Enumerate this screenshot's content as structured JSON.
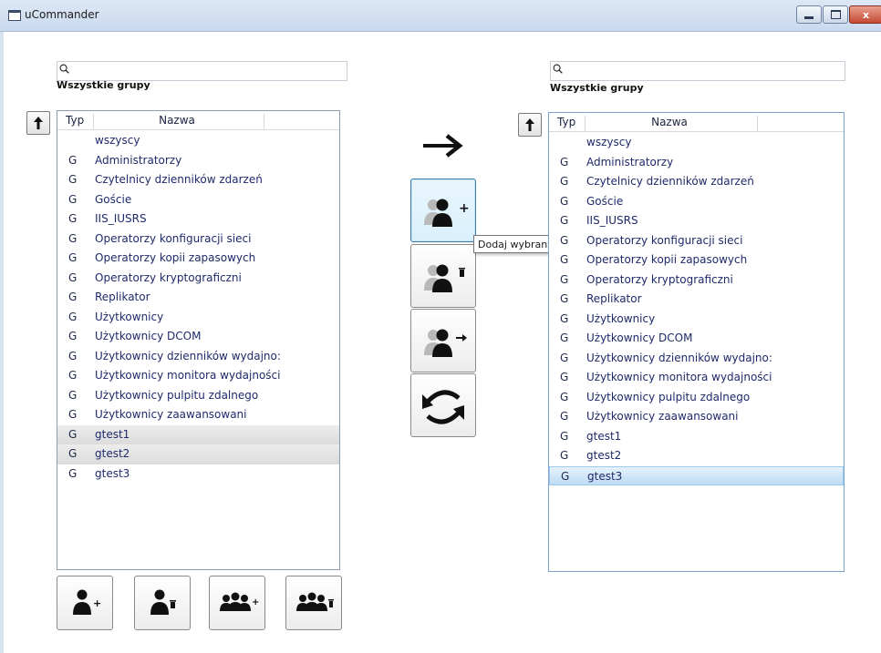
{
  "window": {
    "title": "uCommander",
    "min_glyph": "",
    "max_glyph": "",
    "close_glyph": "x"
  },
  "left_panel": {
    "search": {
      "value": "",
      "placeholder": ""
    },
    "group_label": "Wszystkie grupy",
    "up_button": "🡑",
    "headers": {
      "typ": "Typ",
      "nazwa": "Nazwa"
    },
    "rows": [
      {
        "typ": "",
        "nazwa": "wszyscy",
        "state": "normal"
      },
      {
        "typ": "G",
        "nazwa": "Administratorzy",
        "state": "normal"
      },
      {
        "typ": "G",
        "nazwa": "Czytelnicy dzienników zdarzeń",
        "state": "normal"
      },
      {
        "typ": "G",
        "nazwa": "Goście",
        "state": "normal"
      },
      {
        "typ": "G",
        "nazwa": "IIS_IUSRS",
        "state": "normal"
      },
      {
        "typ": "G",
        "nazwa": "Operatorzy konfiguracji sieci",
        "state": "normal"
      },
      {
        "typ": "G",
        "nazwa": "Operatorzy kopii zapasowych",
        "state": "normal"
      },
      {
        "typ": "G",
        "nazwa": "Operatorzy kryptograficzni",
        "state": "normal"
      },
      {
        "typ": "G",
        "nazwa": "Replikator",
        "state": "normal"
      },
      {
        "typ": "G",
        "nazwa": "Użytkownicy",
        "state": "normal"
      },
      {
        "typ": "G",
        "nazwa": "Użytkownicy DCOM",
        "state": "normal"
      },
      {
        "typ": "G",
        "nazwa": "Użytkownicy dzienników wydajno:",
        "state": "normal"
      },
      {
        "typ": "G",
        "nazwa": "Użytkownicy monitora wydajności",
        "state": "normal"
      },
      {
        "typ": "G",
        "nazwa": "Użytkownicy pulpitu zdalnego",
        "state": "normal"
      },
      {
        "typ": "G",
        "nazwa": "Użytkownicy zaawansowani",
        "state": "normal"
      },
      {
        "typ": "G",
        "nazwa": "gtest1",
        "state": "selected-grey"
      },
      {
        "typ": "G",
        "nazwa": "gtest2",
        "state": "selected-grey"
      },
      {
        "typ": "G",
        "nazwa": "gtest3",
        "state": "normal"
      }
    ]
  },
  "right_panel": {
    "search": {
      "value": "",
      "placeholder": ""
    },
    "group_label": "Wszystkie grupy",
    "up_button": "🡑",
    "headers": {
      "typ": "Typ",
      "nazwa": "Nazwa"
    },
    "rows": [
      {
        "typ": "",
        "nazwa": "wszyscy",
        "state": "normal"
      },
      {
        "typ": "G",
        "nazwa": "Administratorzy",
        "state": "normal"
      },
      {
        "typ": "G",
        "nazwa": "Czytelnicy dzienników zdarzeń",
        "state": "normal"
      },
      {
        "typ": "G",
        "nazwa": "Goście",
        "state": "normal"
      },
      {
        "typ": "G",
        "nazwa": "IIS_IUSRS",
        "state": "normal"
      },
      {
        "typ": "G",
        "nazwa": "Operatorzy konfiguracji sieci",
        "state": "normal"
      },
      {
        "typ": "G",
        "nazwa": "Operatorzy kopii zapasowych",
        "state": "normal"
      },
      {
        "typ": "G",
        "nazwa": "Operatorzy kryptograficzni",
        "state": "normal"
      },
      {
        "typ": "G",
        "nazwa": "Replikator",
        "state": "normal"
      },
      {
        "typ": "G",
        "nazwa": "Użytkownicy",
        "state": "normal"
      },
      {
        "typ": "G",
        "nazwa": "Użytkownicy DCOM",
        "state": "normal"
      },
      {
        "typ": "G",
        "nazwa": "Użytkownicy dzienników wydajno:",
        "state": "normal"
      },
      {
        "typ": "G",
        "nazwa": "Użytkownicy monitora wydajności",
        "state": "normal"
      },
      {
        "typ": "G",
        "nazwa": "Użytkownicy pulpitu zdalnego",
        "state": "normal"
      },
      {
        "typ": "G",
        "nazwa": "Użytkownicy zaawansowani",
        "state": "normal"
      },
      {
        "typ": "G",
        "nazwa": "gtest1",
        "state": "normal"
      },
      {
        "typ": "G",
        "nazwa": "gtest2",
        "state": "normal"
      },
      {
        "typ": "G",
        "nazwa": "gtest3",
        "state": "selected-blue"
      }
    ]
  },
  "middle": {
    "transfer_arrow": "arrow-right-icon",
    "buttons": [
      {
        "name": "add-users-to-groups-button",
        "icon": "user-add-icon"
      },
      {
        "name": "remove-users-from-groups-button",
        "icon": "user-delete-icon"
      },
      {
        "name": "move-users-button",
        "icon": "user-move-icon"
      },
      {
        "name": "refresh-button",
        "icon": "refresh-icon"
      }
    ],
    "tooltip": "Dodaj wybranych użytkowników do wybranych grup"
  },
  "bottom_buttons": [
    {
      "name": "add-user-button",
      "icon": "user-add-icon"
    },
    {
      "name": "delete-user-button",
      "icon": "user-delete-icon"
    },
    {
      "name": "add-group-button",
      "icon": "group-add-icon"
    },
    {
      "name": "delete-group-button",
      "icon": "group-delete-icon"
    }
  ],
  "colors": {
    "selection_blue": "#bfdcf4",
    "selection_grey": "#dcdcdc",
    "title_bar": "#c9d9ee",
    "close_red": "#c44a33"
  }
}
